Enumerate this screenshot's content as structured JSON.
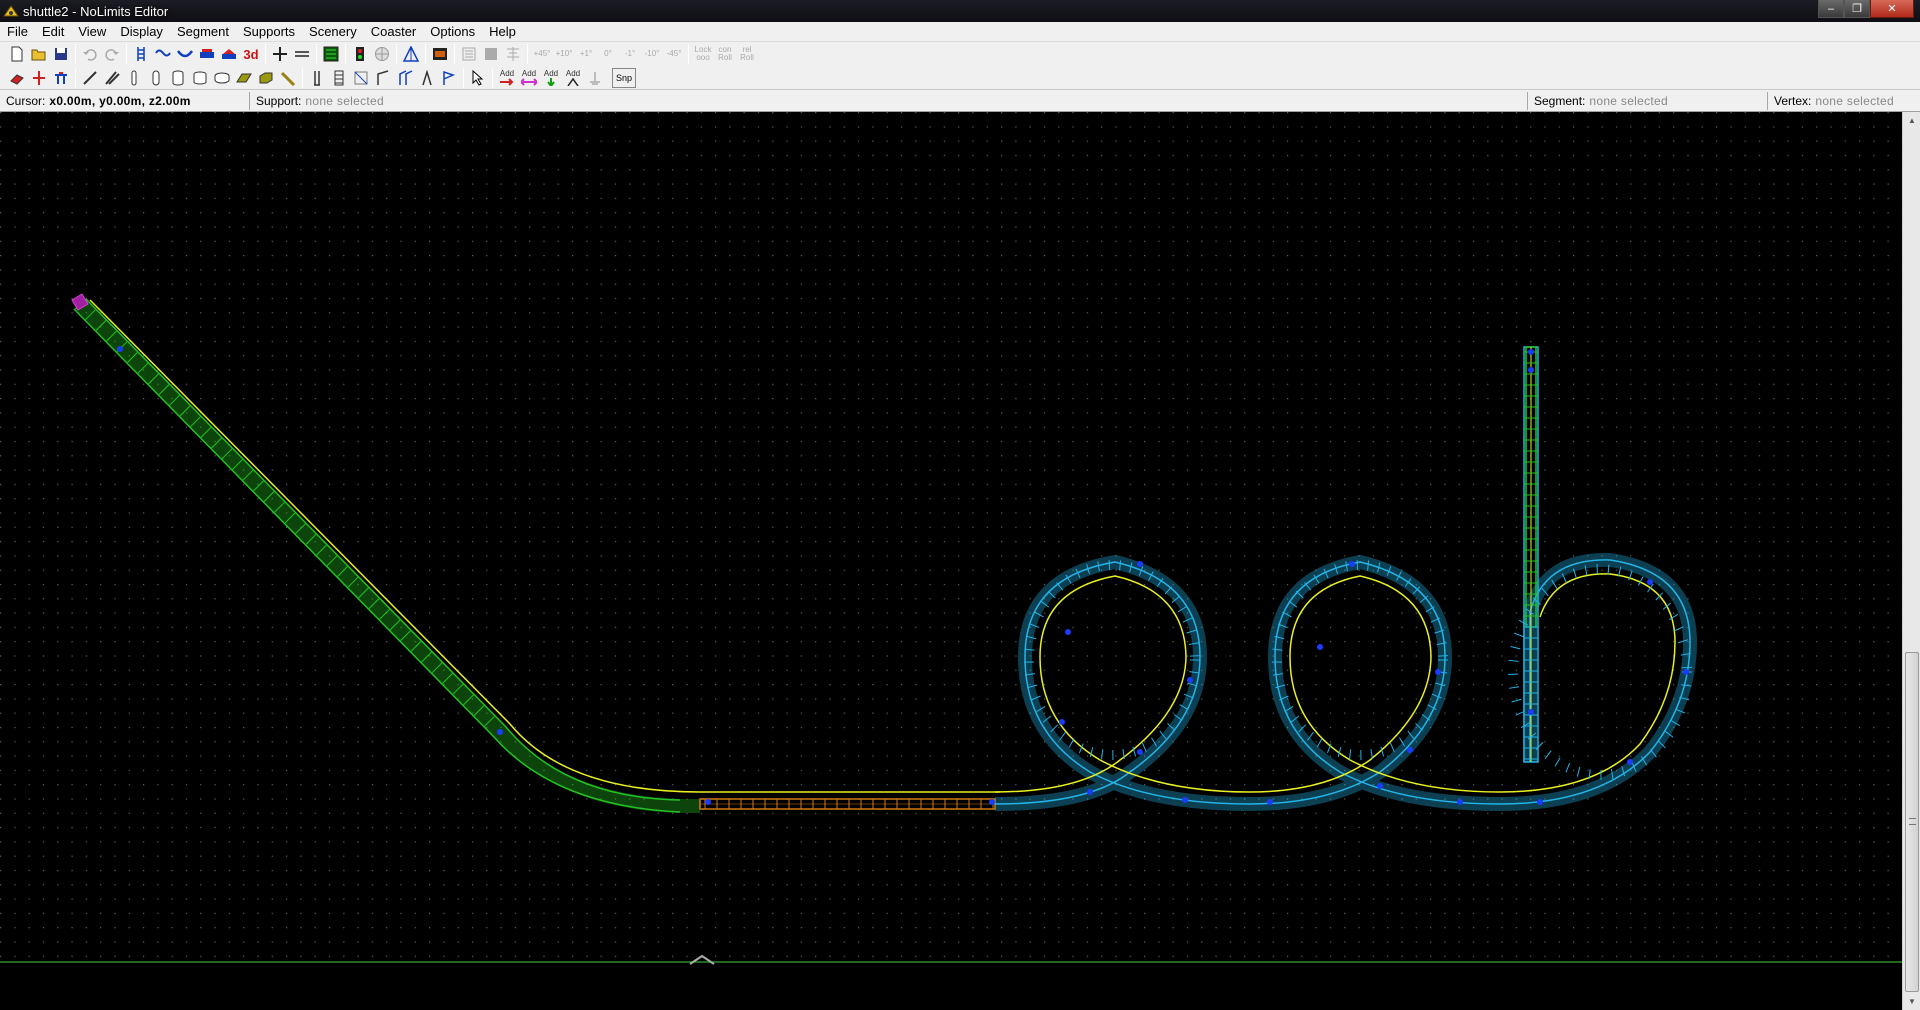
{
  "window": {
    "title": "shuttle2 - NoLimits Editor",
    "minimize_glyph": "–",
    "maximize_glyph": "❐",
    "close_glyph": "✕"
  },
  "menu": [
    "File",
    "Edit",
    "View",
    "Display",
    "Segment",
    "Supports",
    "Scenery",
    "Coaster",
    "Options",
    "Help"
  ],
  "toolbar1": {
    "label_3d": "3d",
    "angle_buttons": [
      "+45°",
      "+10°",
      "+1°",
      "0°",
      "-1°",
      "-10°",
      "-45°"
    ],
    "lock_top": "Lock",
    "lock_bottom": "ooo",
    "con_top": "con",
    "con_bottom": "Roll",
    "rel_top": "rel",
    "rel_bottom": "Roll"
  },
  "toolbar2": {
    "add_label": "Add",
    "snap_label": "Snp"
  },
  "status": {
    "cursor_label": "Cursor:",
    "cursor_value": "x0.00m, y0.00m, z2.00m",
    "support_label": "Support:",
    "support_value": "none selected",
    "segment_label": "Segment:",
    "segment_value": "none selected",
    "vertex_label": "Vertex:",
    "vertex_value": "none selected"
  },
  "colors": {
    "grid_dot": "#5a6a5a",
    "lift_track": "#22c422",
    "loop_track": "#22b4e8",
    "station_track": "#d07a10",
    "centerline": "#e8f020",
    "vertex": "#1a3cff",
    "start_marker": "#a020a0",
    "ground_line": "#2a8a2a"
  }
}
